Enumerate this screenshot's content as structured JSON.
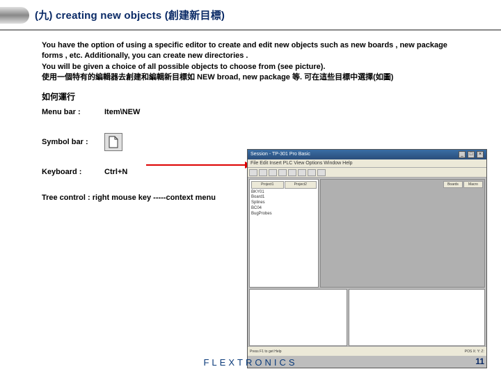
{
  "header": {
    "title": "(九) creating new objects (創建新目標)"
  },
  "intro": {
    "p1": "You have the option of using a specific editor to create and edit new objects such as  new boards , new package  forms , etc. Additionally, you can create new directories .",
    "p2": "You will be given a choice of all possible objects to choose from (see picture).",
    "p3": " 使用一個特有的編輯器去創建和編輯新目標如 NEW broad, new package 等. 可在這些目標中選擇(如圖)"
  },
  "subheader": "如何運行 ",
  "rows": {
    "menu_label": "Menu bar :",
    "menu_value": "Item\\NEW",
    "symbol_label": "Symbol bar :",
    "keyboard_label": "Keyboard :",
    "keyboard_value": "Ctrl+N",
    "tree_text": "Tree control :  right mouse key -----context menu"
  },
  "screenshot": {
    "title": "Session - TP-301 Pro Basic",
    "menu_items": "File  Edit  Insert  PLC  View  Options  Window  Help",
    "side_tabs": [
      "Project1",
      "Project2"
    ],
    "side_items": [
      "BKY01",
      "Board1",
      "Splines",
      "BC04",
      "BugProbes"
    ],
    "canvas_tabs": [
      "Boards",
      "Macro"
    ],
    "status_left": "Press F1 to get Help",
    "status_right": "POS X:  Y:  Z:"
  },
  "footer": {
    "logo": "FLEXTRONICS",
    "page": "11"
  }
}
